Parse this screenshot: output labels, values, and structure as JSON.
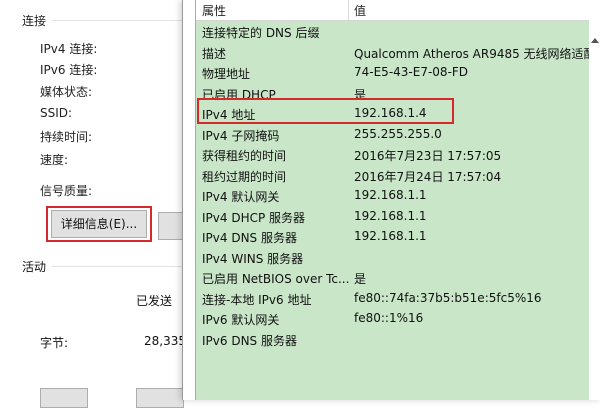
{
  "status": {
    "connection_header": "连接",
    "connection_rows": [
      "IPv4 连接:",
      "IPv6 连接:",
      "媒体状态:",
      "SSID:",
      "持续时间:",
      "速度:"
    ],
    "signal_label": "信号质量:",
    "details_button": "详细信息(E)...",
    "activity_header": "活动",
    "sent_label": "已发送",
    "bytes_label": "字节:",
    "bytes_sent": "28,335"
  },
  "details": {
    "col_property": "属性",
    "col_value": "值",
    "rows": [
      {
        "p": "连接特定的 DNS 后缀",
        "v": ""
      },
      {
        "p": "描述",
        "v": "Qualcomm Atheros AR9485 无线网络适配"
      },
      {
        "p": "物理地址",
        "v": "74-E5-43-E7-08-FD"
      },
      {
        "p": "已启用 DHCP",
        "v": "是"
      },
      {
        "p": "IPv4 地址",
        "v": "192.168.1.4"
      },
      {
        "p": "IPv4 子网掩码",
        "v": "255.255.255.0"
      },
      {
        "p": "获得租约的时间",
        "v": "2016年7月23日 17:57:05"
      },
      {
        "p": "租约过期的时间",
        "v": "2016年7月24日 17:57:04"
      },
      {
        "p": "IPv4 默认网关",
        "v": "192.168.1.1"
      },
      {
        "p": "IPv4 DHCP 服务器",
        "v": "192.168.1.1"
      },
      {
        "p": "IPv4 DNS 服务器",
        "v": "192.168.1.1"
      },
      {
        "p": "IPv4 WINS 服务器",
        "v": ""
      },
      {
        "p": "已启用 NetBIOS over Tc...",
        "v": "是"
      },
      {
        "p": "连接-本地 IPv6 地址",
        "v": "fe80::74fa:37b5:b51e:5fc5%16"
      },
      {
        "p": "IPv6 默认网关",
        "v": "fe80::1%16"
      },
      {
        "p": "IPv6 DNS 服务器",
        "v": ""
      }
    ]
  },
  "colors": {
    "list_background": "#c9e6c9",
    "highlight_border": "#d42a2a"
  }
}
